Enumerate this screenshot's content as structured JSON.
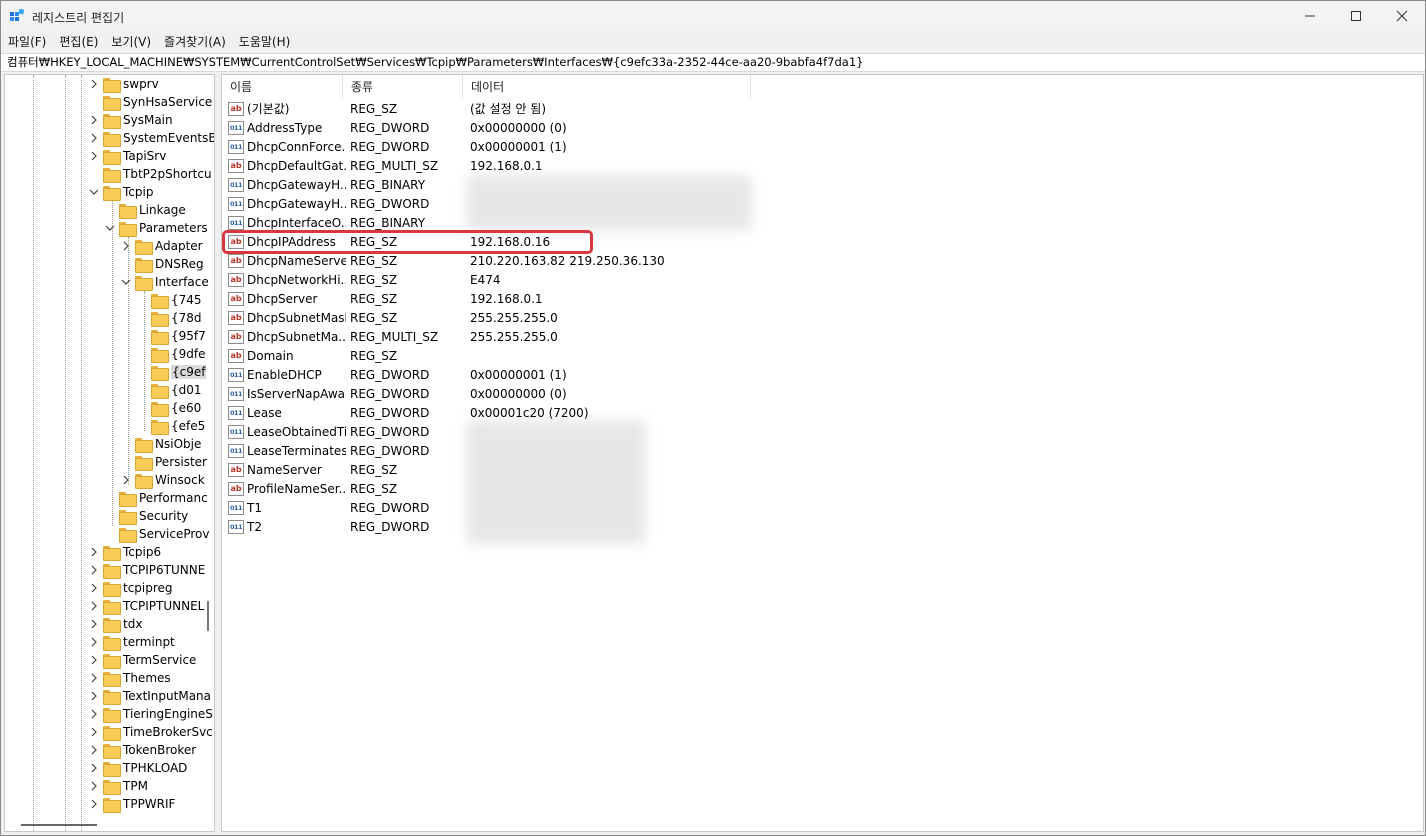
{
  "window": {
    "title": "레지스트리 편집기",
    "controls": {
      "minimize": "minimize-icon",
      "maximize": "maximize-icon",
      "close": "close-icon"
    }
  },
  "menu": [
    "파일(F)",
    "편집(E)",
    "보기(V)",
    "즐겨찾기(A)",
    "도움말(H)"
  ],
  "address": "컴퓨터₩HKEY_LOCAL_MACHINE₩SYSTEM₩CurrentControlSet₩Services₩Tcpip₩Parameters₩Interfaces₩{c9efc33a-2352-44ce-aa20-9babfa4f7da1}",
  "tree": [
    {
      "label": "swprv",
      "level": 0,
      "expander": "collapsed"
    },
    {
      "label": "SynHsaService",
      "level": 0,
      "expander": "none"
    },
    {
      "label": "SysMain",
      "level": 0,
      "expander": "collapsed"
    },
    {
      "label": "SystemEventsB",
      "level": 0,
      "expander": "collapsed"
    },
    {
      "label": "TapiSrv",
      "level": 0,
      "expander": "collapsed"
    },
    {
      "label": "TbtP2pShortcu",
      "level": 0,
      "expander": "none"
    },
    {
      "label": "Tcpip",
      "level": 0,
      "expander": "expanded"
    },
    {
      "label": "Linkage",
      "level": 1,
      "expander": "none"
    },
    {
      "label": "Parameters",
      "level": 1,
      "expander": "expanded"
    },
    {
      "label": "Adapter",
      "level": 2,
      "expander": "collapsed"
    },
    {
      "label": "DNSReg",
      "level": 2,
      "expander": "none"
    },
    {
      "label": "Interface",
      "level": 2,
      "expander": "expanded"
    },
    {
      "label": "{745",
      "level": 3,
      "expander": "none"
    },
    {
      "label": "{78d",
      "level": 3,
      "expander": "none"
    },
    {
      "label": "{95f7",
      "level": 3,
      "expander": "none"
    },
    {
      "label": "{9dfe",
      "level": 3,
      "expander": "none"
    },
    {
      "label": "{c9ef",
      "level": 3,
      "expander": "none",
      "selected": true
    },
    {
      "label": "{d01",
      "level": 3,
      "expander": "none"
    },
    {
      "label": "{e60",
      "level": 3,
      "expander": "none"
    },
    {
      "label": "{efe5",
      "level": 3,
      "expander": "none"
    },
    {
      "label": "NsiObje",
      "level": 2,
      "expander": "none"
    },
    {
      "label": "Persister",
      "level": 2,
      "expander": "none"
    },
    {
      "label": "Winsock",
      "level": 2,
      "expander": "collapsed"
    },
    {
      "label": "Performanc",
      "level": 1,
      "expander": "none"
    },
    {
      "label": "Security",
      "level": 1,
      "expander": "none"
    },
    {
      "label": "ServiceProv",
      "level": 1,
      "expander": "none"
    },
    {
      "label": "Tcpip6",
      "level": 0,
      "expander": "collapsed"
    },
    {
      "label": "TCPIP6TUNNE",
      "level": 0,
      "expander": "collapsed"
    },
    {
      "label": "tcpipreg",
      "level": 0,
      "expander": "collapsed"
    },
    {
      "label": "TCPIPTUNNEL",
      "level": 0,
      "expander": "collapsed"
    },
    {
      "label": "tdx",
      "level": 0,
      "expander": "collapsed"
    },
    {
      "label": "terminpt",
      "level": 0,
      "expander": "collapsed"
    },
    {
      "label": "TermService",
      "level": 0,
      "expander": "collapsed"
    },
    {
      "label": "Themes",
      "level": 0,
      "expander": "collapsed"
    },
    {
      "label": "TextInputMana",
      "level": 0,
      "expander": "collapsed"
    },
    {
      "label": "TieringEngineS",
      "level": 0,
      "expander": "collapsed"
    },
    {
      "label": "TimeBrokerSvc",
      "level": 0,
      "expander": "collapsed"
    },
    {
      "label": "TokenBroker",
      "level": 0,
      "expander": "collapsed"
    },
    {
      "label": "TPHKLOAD",
      "level": 0,
      "expander": "collapsed"
    },
    {
      "label": "TPM",
      "level": 0,
      "expander": "collapsed"
    },
    {
      "label": "TPPWRIF",
      "level": 0,
      "expander": "collapsed"
    }
  ],
  "columns": {
    "name": "이름",
    "type": "종류",
    "data": "데이터"
  },
  "entries": [
    {
      "icon": "string-value-icon",
      "name": "(기본값)",
      "type": "REG_SZ",
      "data": "(값 설정 안 됨)"
    },
    {
      "icon": "binary-value-icon",
      "name": "AddressType",
      "type": "REG_DWORD",
      "data": "0x00000000 (0)"
    },
    {
      "icon": "binary-value-icon",
      "name": "DhcpConnForce...",
      "type": "REG_DWORD",
      "data": "0x00000001 (1)"
    },
    {
      "icon": "string-value-icon",
      "name": "DhcpDefaultGat...",
      "type": "REG_MULTI_SZ",
      "data": "192.168.0.1"
    },
    {
      "icon": "binary-value-icon",
      "name": "DhcpGatewayH...",
      "type": "REG_BINARY",
      "data": ""
    },
    {
      "icon": "binary-value-icon",
      "name": "DhcpGatewayH...",
      "type": "REG_DWORD",
      "data": ""
    },
    {
      "icon": "binary-value-icon",
      "name": "DhcpInterfaceO...",
      "type": "REG_BINARY",
      "data": ""
    },
    {
      "icon": "string-value-icon",
      "name": "DhcpIPAddress",
      "type": "REG_SZ",
      "data": "192.168.0.16",
      "highlighted": true
    },
    {
      "icon": "string-value-icon",
      "name": "DhcpNameServer",
      "type": "REG_SZ",
      "data": "210.220.163.82 219.250.36.130"
    },
    {
      "icon": "string-value-icon",
      "name": "DhcpNetworkHi...",
      "type": "REG_SZ",
      "data": "E474"
    },
    {
      "icon": "string-value-icon",
      "name": "DhcpServer",
      "type": "REG_SZ",
      "data": "192.168.0.1"
    },
    {
      "icon": "string-value-icon",
      "name": "DhcpSubnetMask",
      "type": "REG_SZ",
      "data": "255.255.255.0"
    },
    {
      "icon": "string-value-icon",
      "name": "DhcpSubnetMa...",
      "type": "REG_MULTI_SZ",
      "data": "255.255.255.0"
    },
    {
      "icon": "string-value-icon",
      "name": "Domain",
      "type": "REG_SZ",
      "data": ""
    },
    {
      "icon": "binary-value-icon",
      "name": "EnableDHCP",
      "type": "REG_DWORD",
      "data": "0x00000001 (1)"
    },
    {
      "icon": "binary-value-icon",
      "name": "IsServerNapAware",
      "type": "REG_DWORD",
      "data": "0x00000000 (0)"
    },
    {
      "icon": "binary-value-icon",
      "name": "Lease",
      "type": "REG_DWORD",
      "data": "0x00001c20 (7200)"
    },
    {
      "icon": "binary-value-icon",
      "name": "LeaseObtainedTi...",
      "type": "REG_DWORD",
      "data": ""
    },
    {
      "icon": "binary-value-icon",
      "name": "LeaseTerminates...",
      "type": "REG_DWORD",
      "data": ""
    },
    {
      "icon": "string-value-icon",
      "name": "NameServer",
      "type": "REG_SZ",
      "data": ""
    },
    {
      "icon": "string-value-icon",
      "name": "ProfileNameSer...",
      "type": "REG_SZ",
      "data": ""
    },
    {
      "icon": "binary-value-icon",
      "name": "T1",
      "type": "REG_DWORD",
      "data": ""
    },
    {
      "icon": "binary-value-icon",
      "name": "T2",
      "type": "REG_DWORD",
      "data": ""
    }
  ],
  "colors": {
    "highlight_border": "#d8383d",
    "folder": "#f8cc56",
    "string_icon": "#b8352a",
    "binary_icon": "#2d5fa8"
  }
}
